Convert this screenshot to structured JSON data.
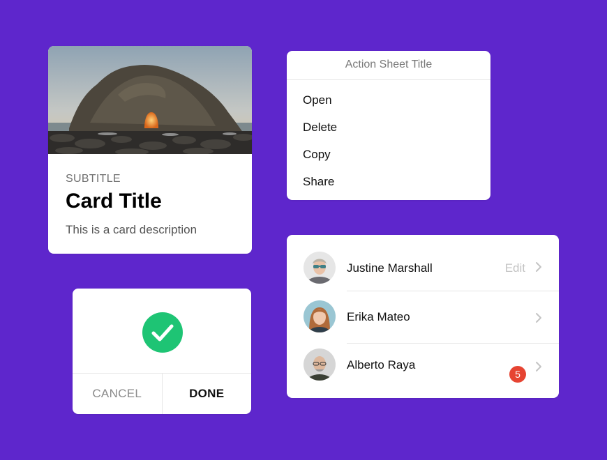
{
  "image_card": {
    "subtitle": "SUBTITLE",
    "title": "Card Title",
    "description": "This is a card description"
  },
  "action_sheet": {
    "title": "Action Sheet Title",
    "items": [
      "Open",
      "Delete",
      "Copy",
      "Share"
    ]
  },
  "confirm_dialog": {
    "icon": "checkmark-icon",
    "cancel_label": "CANCEL",
    "done_label": "DONE",
    "accent": "#1ec474"
  },
  "contacts": [
    {
      "name": "Justine Marshall",
      "action": "Edit"
    },
    {
      "name": "Erika Mateo",
      "badge": "5"
    },
    {
      "name": "Alberto Raya"
    }
  ],
  "colors": {
    "background": "#5e26cc",
    "badge": "#e64432"
  }
}
